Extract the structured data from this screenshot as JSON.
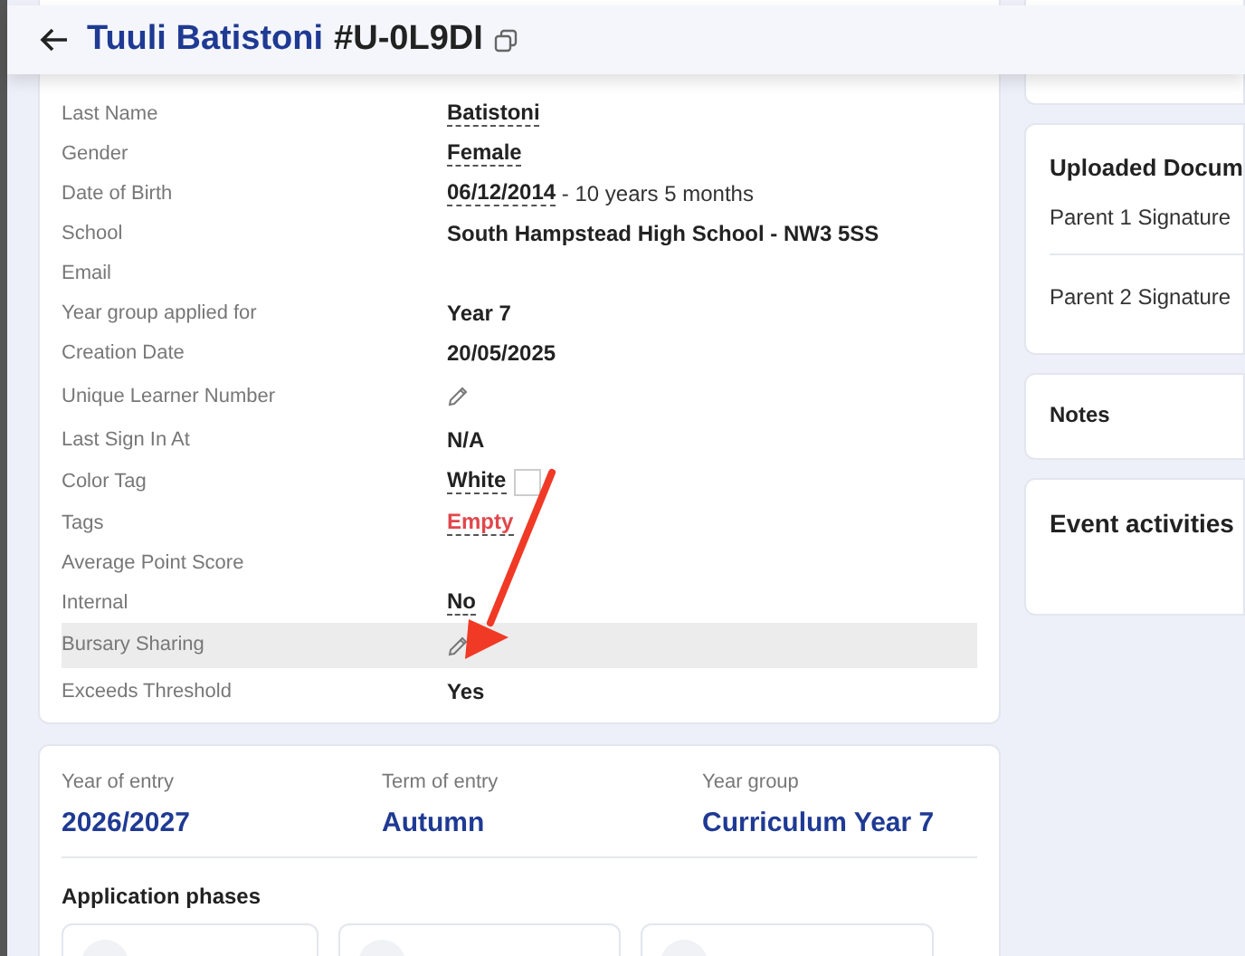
{
  "header": {
    "name": "Tuuli Batistoni",
    "id": "#U-0L9DI"
  },
  "fields": [
    {
      "label": "Last Name",
      "kind": "text",
      "value": "Batistoni",
      "dashed": true,
      "highlighted": false
    },
    {
      "label": "Gender",
      "kind": "text",
      "value": "Female",
      "dashed": true,
      "highlighted": false
    },
    {
      "label": "Date of Birth",
      "kind": "text",
      "value": "06/12/2014",
      "suffix": " - 10 years 5 months",
      "dashed": true,
      "highlighted": false
    },
    {
      "label": "School",
      "kind": "text",
      "value": "South Hampstead High School - NW3 5SS",
      "dashed": false,
      "highlighted": false
    },
    {
      "label": "Email",
      "kind": "none",
      "highlighted": false
    },
    {
      "label": "Year group applied for",
      "kind": "text",
      "value": "Year 7",
      "dashed": false,
      "highlighted": false
    },
    {
      "label": "Creation Date",
      "kind": "text",
      "value": "20/05/2025",
      "dashed": false,
      "highlighted": false
    },
    {
      "label": "Unique Learner Number",
      "kind": "edit",
      "highlighted": false
    },
    {
      "label": "Last Sign In At",
      "kind": "text",
      "value": "N/A",
      "dashed": false,
      "highlighted": false
    },
    {
      "label": "Color Tag",
      "kind": "color",
      "value": "White",
      "color": "#ffffff",
      "dashed": true,
      "highlighted": false
    },
    {
      "label": "Tags",
      "kind": "empty",
      "value": "Empty",
      "dashed": true,
      "highlighted": false
    },
    {
      "label": "Average Point Score",
      "kind": "none",
      "highlighted": false
    },
    {
      "label": "Internal",
      "kind": "text",
      "value": "No",
      "dashed": true,
      "highlighted": false
    },
    {
      "label": "Bursary Sharing",
      "kind": "edit",
      "highlighted": true
    },
    {
      "label": "Exceeds Threshold",
      "kind": "text",
      "value": "Yes",
      "dashed": false,
      "highlighted": false
    }
  ],
  "entry": [
    {
      "label": "Year of entry",
      "value": "2026/2027"
    },
    {
      "label": "Term of entry",
      "value": "Autumn"
    },
    {
      "label": "Year group",
      "value": "Curriculum Year 7"
    }
  ],
  "application_phases": {
    "title": "Application phases"
  },
  "uploaded_documents": {
    "title": "Uploaded Docum",
    "items": [
      "Parent 1 Signature",
      "Parent 2 Signature"
    ]
  },
  "notes": {
    "title": "Notes"
  },
  "event_activities": {
    "title": "Event activities"
  }
}
